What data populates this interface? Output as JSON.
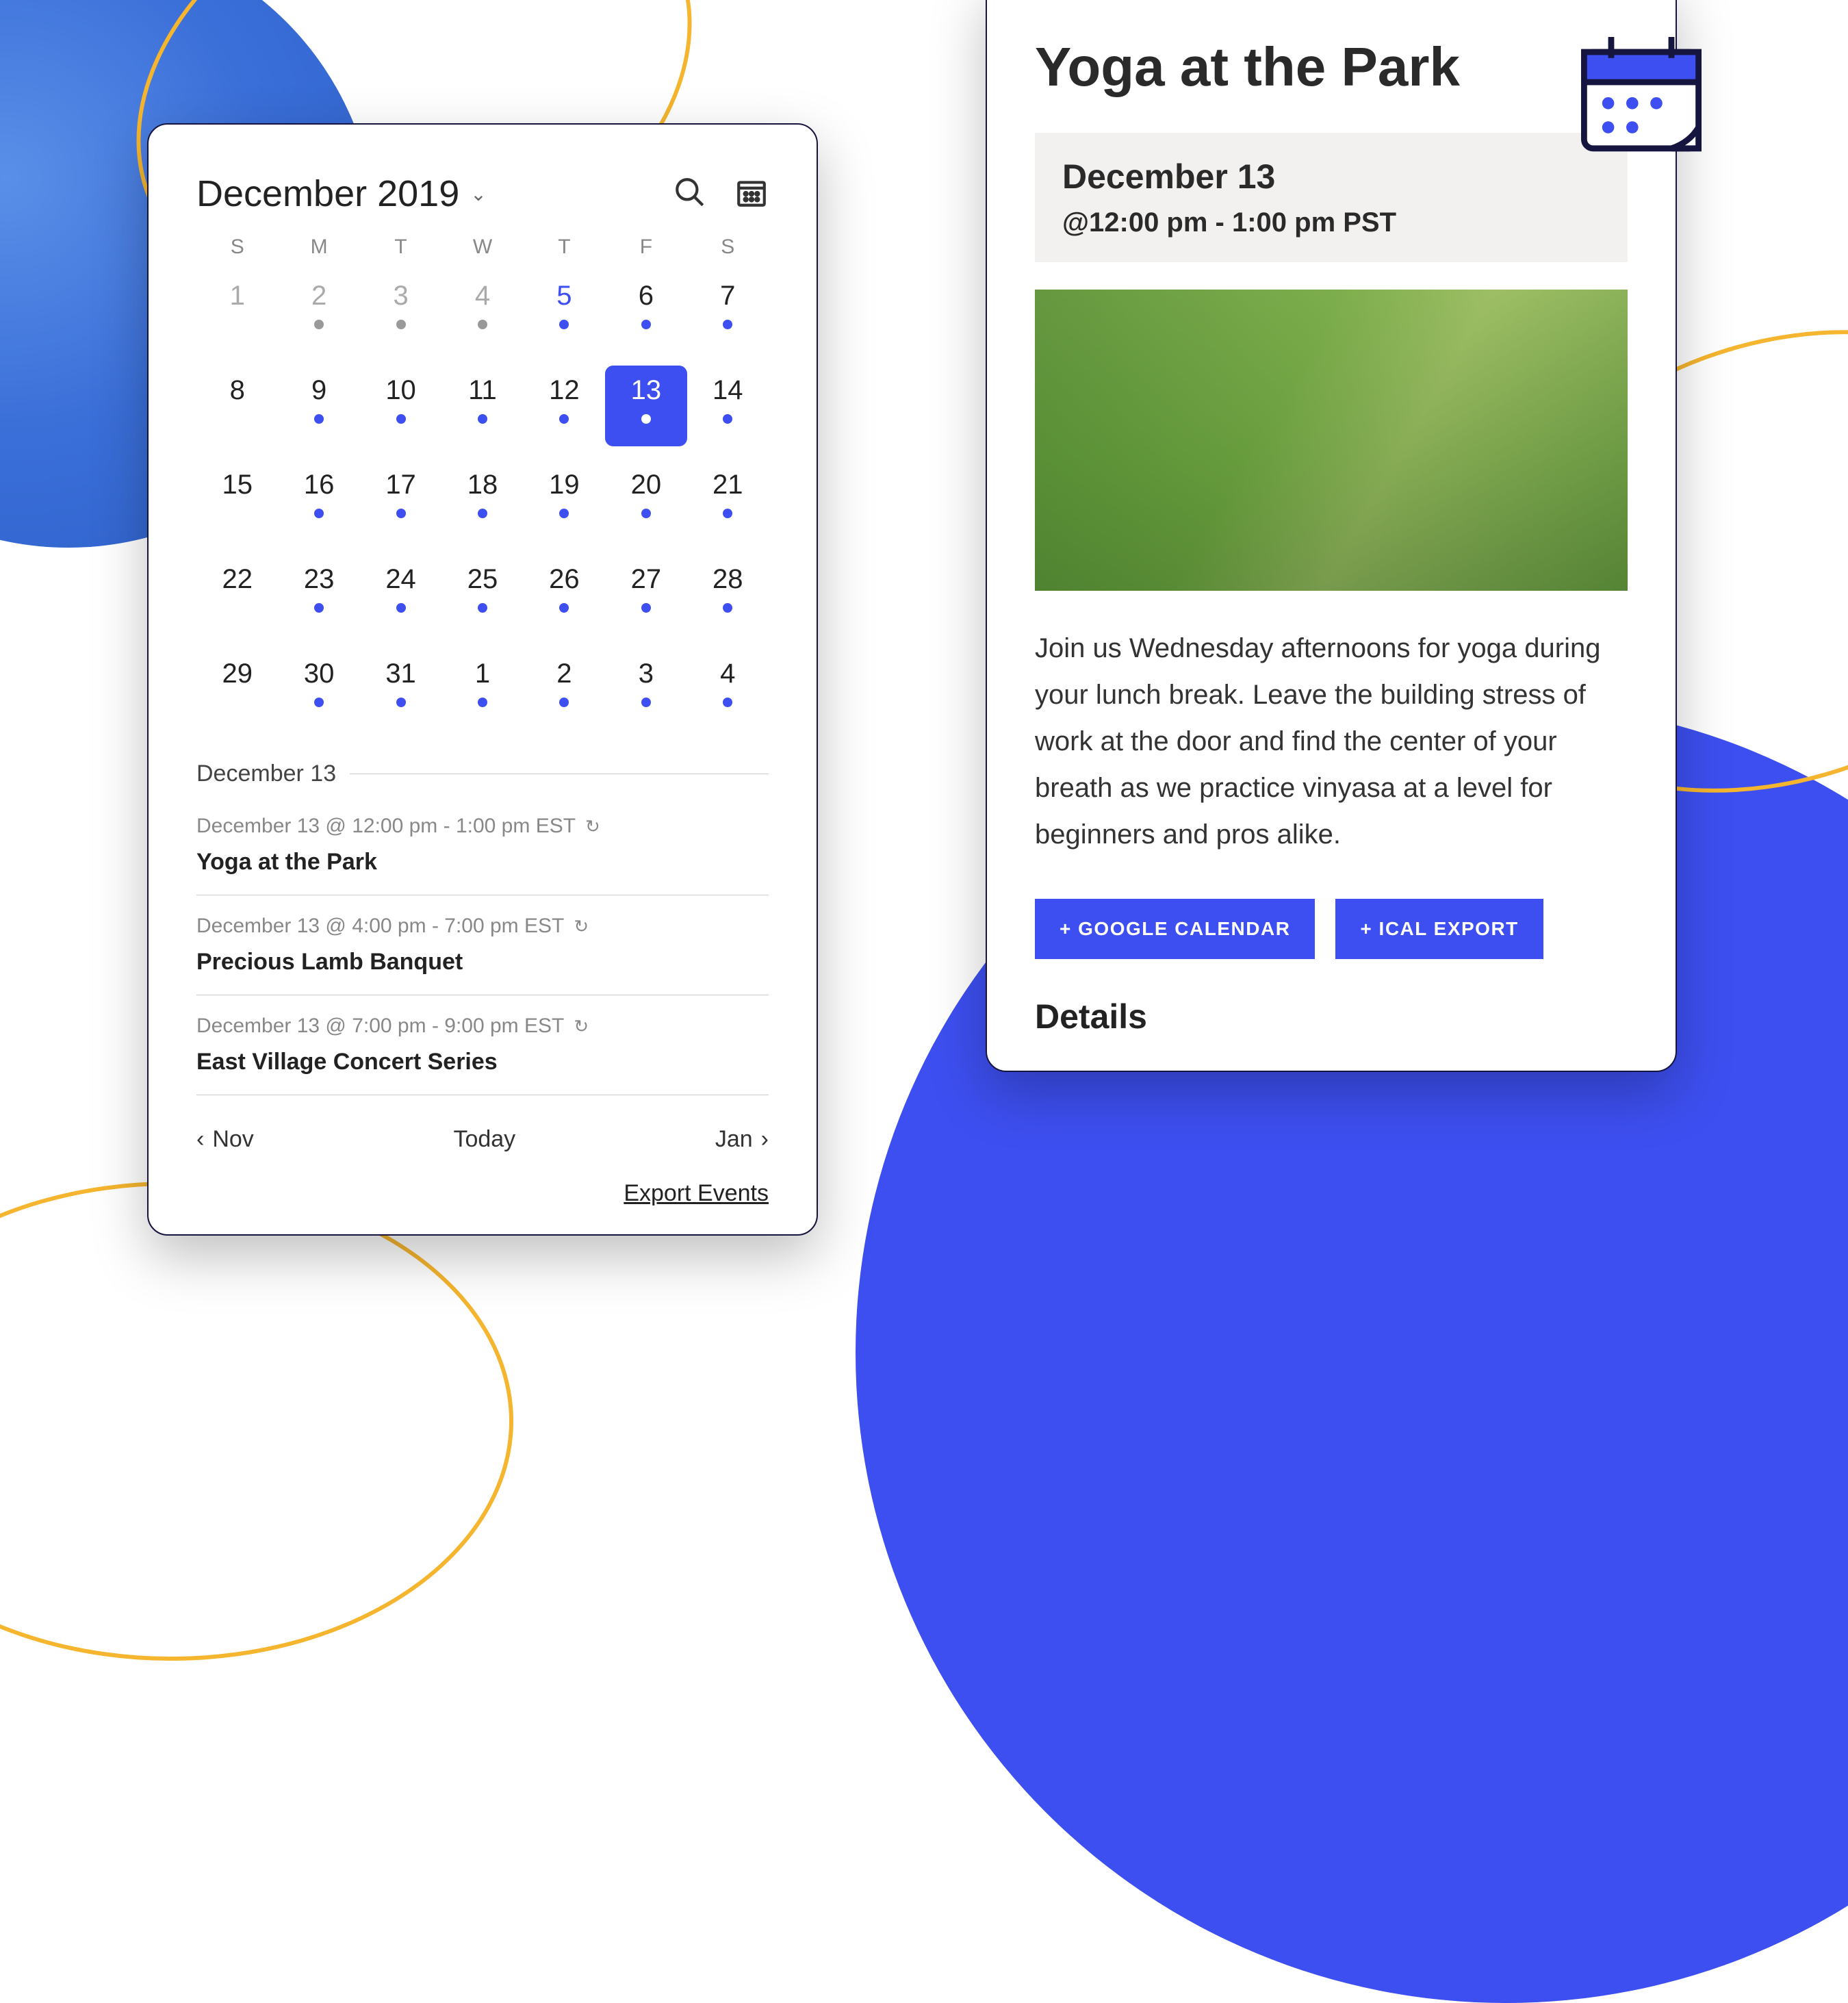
{
  "calendar": {
    "title": "December 2019",
    "dow": [
      "S",
      "M",
      "T",
      "W",
      "T",
      "F",
      "S"
    ],
    "selected_label": "December 13",
    "cells": [
      {
        "n": "1",
        "faded": true,
        "dot": null
      },
      {
        "n": "2",
        "faded": true,
        "dot": "gray"
      },
      {
        "n": "3",
        "faded": true,
        "dot": "gray"
      },
      {
        "n": "4",
        "faded": true,
        "dot": "gray"
      },
      {
        "n": "5",
        "link": true,
        "dot": "blue"
      },
      {
        "n": "6",
        "dot": "blue"
      },
      {
        "n": "7",
        "dot": "blue"
      },
      {
        "n": "8",
        "dot": null
      },
      {
        "n": "9",
        "dot": "blue"
      },
      {
        "n": "10",
        "dot": "blue"
      },
      {
        "n": "11",
        "dot": "blue"
      },
      {
        "n": "12",
        "dot": "blue"
      },
      {
        "n": "13",
        "sel": true,
        "dot": "white"
      },
      {
        "n": "14",
        "dot": "blue"
      },
      {
        "n": "15",
        "dot": null
      },
      {
        "n": "16",
        "dot": "blue"
      },
      {
        "n": "17",
        "dot": "blue"
      },
      {
        "n": "18",
        "dot": "blue"
      },
      {
        "n": "19",
        "dot": "blue"
      },
      {
        "n": "20",
        "dot": "blue"
      },
      {
        "n": "21",
        "dot": "blue"
      },
      {
        "n": "22",
        "dot": null
      },
      {
        "n": "23",
        "dot": "blue"
      },
      {
        "n": "24",
        "dot": "blue"
      },
      {
        "n": "25",
        "dot": "blue"
      },
      {
        "n": "26",
        "dot": "blue"
      },
      {
        "n": "27",
        "dot": "blue"
      },
      {
        "n": "28",
        "dot": "blue"
      },
      {
        "n": "29",
        "dot": null
      },
      {
        "n": "30",
        "dot": "blue"
      },
      {
        "n": "31",
        "dot": "blue"
      },
      {
        "n": "1",
        "dot": "blue"
      },
      {
        "n": "2",
        "dot": "blue"
      },
      {
        "n": "3",
        "dot": "blue"
      },
      {
        "n": "4",
        "dot": "blue"
      }
    ],
    "events": [
      {
        "time": "December 13 @ 12:00 pm - 1:00 pm EST",
        "title": "Yoga at the Park",
        "repeat": true
      },
      {
        "time": "December 13 @ 4:00 pm - 7:00 pm EST",
        "title": "Precious Lamb Banquet",
        "repeat": true
      },
      {
        "time": "December 13 @ 7:00 pm - 9:00 pm EST",
        "title": "East Village Concert Series",
        "repeat": true
      }
    ],
    "nav": {
      "prev": "Nov",
      "today": "Today",
      "next": "Jan"
    },
    "export_label": "Export Events"
  },
  "detail": {
    "title": "Yoga at the Park",
    "date": "December 13",
    "time": "@12:00 pm - 1:00 pm PST",
    "description": "Join us Wednesday afternoons for yoga during your lunch break.  Leave the building stress of work at the door and find the center of your breath as we practice vinyasa at a level for beginners and pros alike.",
    "btn_google": "+ GOOGLE CALENDAR",
    "btn_ical": "+ ICAL EXPORT",
    "section": "Details"
  }
}
